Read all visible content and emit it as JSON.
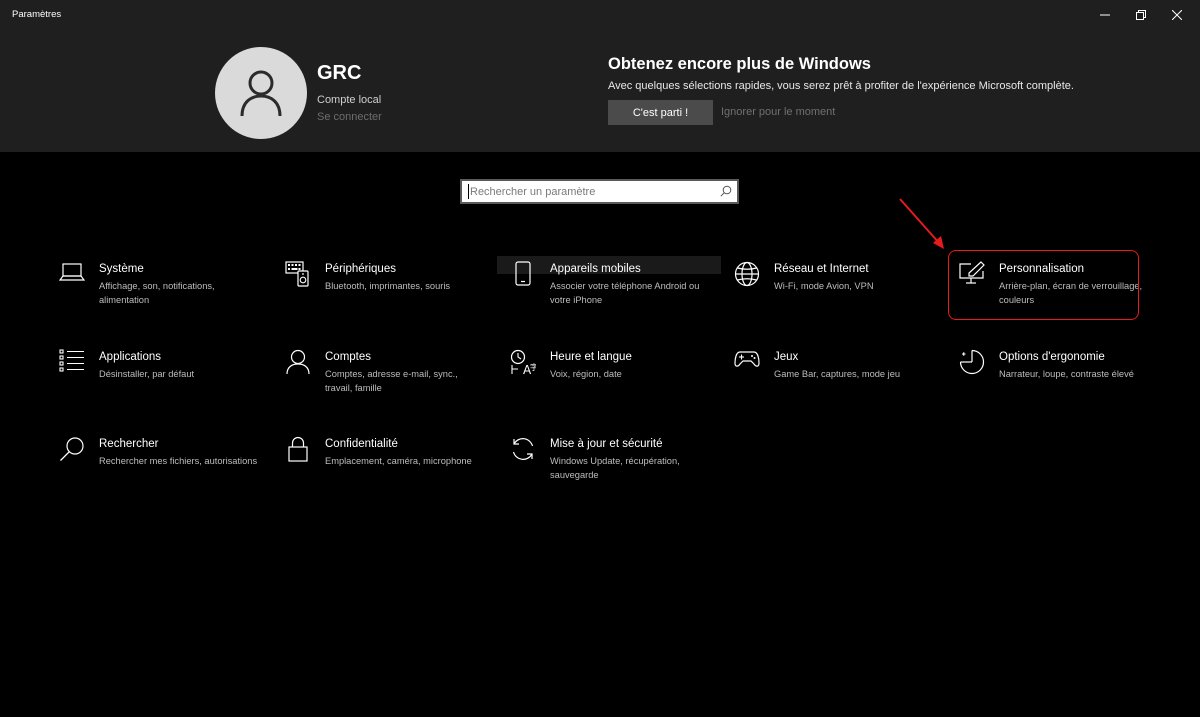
{
  "window": {
    "title": "Paramètres",
    "controls": {
      "minimize": "minimize-icon",
      "maximize": "restore-icon",
      "close": "close-icon"
    }
  },
  "account": {
    "name": "GRC",
    "type": "Compte local",
    "signin": "Se connecter"
  },
  "promo": {
    "title": "Obtenez encore plus de Windows",
    "description": "Avec quelques sélections rapides, vous serez prêt à profiter de l'expérience Microsoft complète.",
    "primary_label": "C'est parti !",
    "secondary_label": "Ignorer pour le moment"
  },
  "search": {
    "placeholder": "Rechercher un paramètre",
    "icon": "search-icon"
  },
  "tiles": [
    {
      "name": "Système",
      "desc": "Affichage, son, notifications, alimentation",
      "icon": "laptop-icon"
    },
    {
      "name": "Périphériques",
      "desc": "Bluetooth, imprimantes, souris",
      "icon": "devices-icon"
    },
    {
      "name": "Appareils mobiles",
      "desc": "Associer votre téléphone Android ou votre iPhone",
      "icon": "phone-icon"
    },
    {
      "name": "Réseau et Internet",
      "desc": "Wi-Fi, mode Avion, VPN",
      "icon": "globe-icon"
    },
    {
      "name": "Personnalisation",
      "desc": "Arrière-plan, écran de verrouillage, couleurs",
      "icon": "personalization-icon"
    },
    {
      "name": "Applications",
      "desc": "Désinstaller, par défaut",
      "icon": "apps-list-icon"
    },
    {
      "name": "Comptes",
      "desc": "Comptes, adresse e-mail, sync., travail, famille",
      "icon": "person-icon"
    },
    {
      "name": "Heure et langue",
      "desc": "Voix, région, date",
      "icon": "time-language-icon"
    },
    {
      "name": "Jeux",
      "desc": "Game Bar, captures, mode jeu",
      "icon": "gamepad-icon"
    },
    {
      "name": "Options d'ergonomie",
      "desc": "Narrateur, loupe, contraste élevé",
      "icon": "ease-of-access-icon"
    },
    {
      "name": "Rechercher",
      "desc": "Rechercher mes fichiers, autorisations",
      "icon": "magnifier-icon"
    },
    {
      "name": "Confidentialité",
      "desc": "Emplacement, caméra, microphone",
      "icon": "lock-icon"
    },
    {
      "name": "Mise à jour et sécurité",
      "desc": "Windows Update, récupération, sauvegarde",
      "icon": "update-icon"
    }
  ],
  "colors": {
    "background": "#000000",
    "header": "#1f1f1f",
    "annotation": "#e81a1a",
    "secondary_text": "#bdbdbd"
  }
}
